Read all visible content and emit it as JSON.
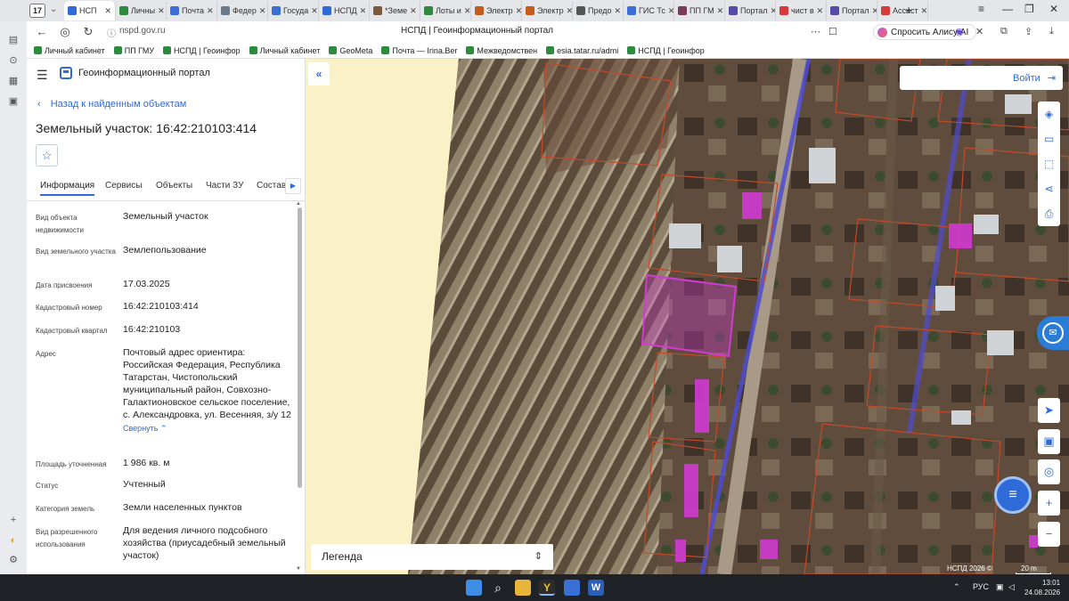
{
  "browser": {
    "tab_count": "17",
    "tabs": [
      {
        "label": "НСП",
        "color": "#2f6ad9",
        "active": true
      },
      {
        "label": "Личны",
        "color": "#2d8a3e"
      },
      {
        "label": "Почта",
        "color": "#3a6fd8"
      },
      {
        "label": "Федер",
        "color": "#6a7a8a"
      },
      {
        "label": "Госуда",
        "color": "#3a6fd8"
      },
      {
        "label": "НСПД",
        "color": "#2f6ad9"
      },
      {
        "label": "*Земе",
        "color": "#7a5a3a"
      },
      {
        "label": "Лоты и",
        "color": "#2d8a3e"
      },
      {
        "label": "Электр",
        "color": "#c65a1a"
      },
      {
        "label": "Электр",
        "color": "#c65a1a"
      },
      {
        "label": "Предо",
        "color": "#555"
      },
      {
        "label": "ГИС Тс",
        "color": "#3a6fd8"
      },
      {
        "label": "ПП ГМ",
        "color": "#7a3a5a"
      },
      {
        "label": "Портал",
        "color": "#5a4aa8"
      },
      {
        "label": "чист в",
        "color": "#d83a3a"
      },
      {
        "label": "Портал",
        "color": "#5a4aa8"
      },
      {
        "label": "Ассист",
        "color": "#d83a3a"
      }
    ],
    "url": "nspd.gov.ru",
    "page_title": "НСПД | Геоинформационный портал",
    "alice_label": "Спросить Алису AI",
    "bookmarks": [
      "Личный кабинет",
      "ПП ГМУ",
      "НСПД | Геоинфор",
      "Личный кабинет",
      "GeoMeta",
      "Почта — Irina.Ber",
      "Межведомствен",
      "esia.tatar.ru/admi",
      "НСПД | Геоинфор"
    ]
  },
  "panel": {
    "portal_name": "Геоинформационный портал",
    "back_link": "Назад к найденным объектам",
    "object_title": "Земельный участок: 16:42:210103:414",
    "favorite_icon": "star-icon",
    "tabs": [
      "Информация",
      "Сервисы",
      "Объекты",
      "Части ЗУ",
      "Состав"
    ],
    "fields": [
      {
        "label": "Вид объекта недвижимости",
        "value": "Земельный участок"
      },
      {
        "label": "Вид земельного участка",
        "value": "Землепользование"
      },
      {
        "label": "Дата присвоения",
        "value": "17.03.2025"
      },
      {
        "label": "Кадастровый номер",
        "value": "16:42:210103:414"
      },
      {
        "label": "Кадастровый квартал",
        "value": "16:42:210103"
      },
      {
        "label": "Адрес",
        "value": "Почтовый адрес ориентира: Российская Федерация, Республика Татарстан, Чистопольский муниципальный район, Совхозно-Галактионовское сельское поселение, с. Александровка, ул. Весенняя, з/у 12"
      },
      {
        "label": "Площадь уточненная",
        "value": "1 986 кв. м"
      },
      {
        "label": "Статус",
        "value": "Учтенный"
      },
      {
        "label": "Категория земель",
        "value": "Земли населенных пунктов"
      },
      {
        "label": "Вид разрешенного использования",
        "value": "Для ведения личного подсобного хозяйства (приусадебный земельный участок)"
      }
    ],
    "collapse_link": "Свернуть"
  },
  "map": {
    "login_label": "Войти",
    "legend_label": "Легенда",
    "copyright": "НСПД 2026 ©",
    "scale": "20 m",
    "accent_color": "#2f6ad9",
    "parcel_color": "#d23ad2"
  },
  "taskbar": {
    "lang": "РУС",
    "time": "13:01",
    "date": "24.08.2026"
  }
}
